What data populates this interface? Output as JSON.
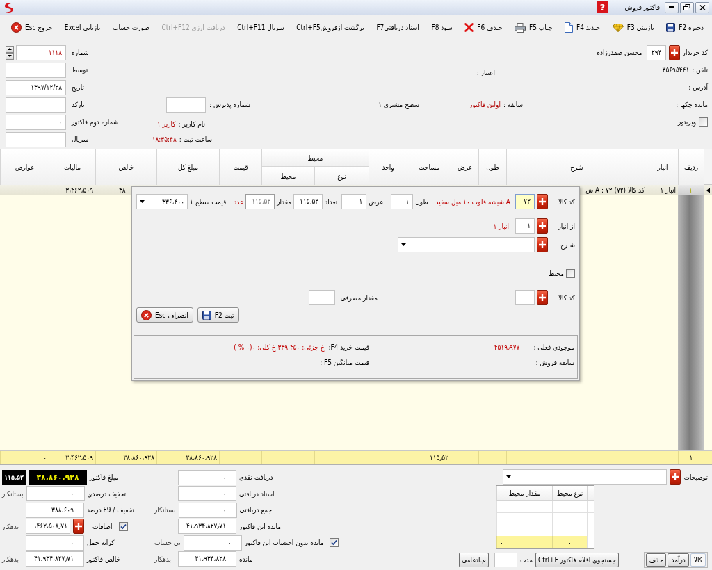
{
  "window": {
    "title": "فاکتور فروش",
    "help": "?"
  },
  "toolbar": [
    {
      "kind": "save",
      "label": "ذخیره F2",
      "disabled": false
    },
    {
      "kind": "review",
      "label": "بازبینی F3",
      "disabled": false
    },
    {
      "kind": "new",
      "label": "جـدید F4",
      "disabled": false
    },
    {
      "kind": "print",
      "label": "چـاپ F5",
      "disabled": false
    },
    {
      "kind": "delete",
      "label": "حـذف F6",
      "disabled": false
    },
    {
      "kind": "text",
      "label": "سود F8",
      "disabled": false
    },
    {
      "kind": "text",
      "label": "اسناد دریافتیF7",
      "disabled": false
    },
    {
      "kind": "text",
      "label": "برگشت ازفروشCtrl+F5",
      "disabled": false
    },
    {
      "kind": "text",
      "label": "سریال Ctrl+F11",
      "disabled": false
    },
    {
      "kind": "text",
      "label": "دریافت ارزی Ctrl+F12",
      "disabled": true
    },
    {
      "kind": "text",
      "label": "صورت حساب",
      "disabled": false
    },
    {
      "kind": "text",
      "label": "بازیابی Excel",
      "disabled": false
    },
    {
      "kind": "exit",
      "label": "خروج Esc",
      "disabled": false
    }
  ],
  "header": {
    "customer": {
      "code_label": "کد خریدار",
      "code": "۲۹۴",
      "name": "محسن صفدرزاده",
      "phone_label": "تلفن :",
      "phone": "۳۵۶۹۵۴۴۱",
      "address_label": "آدرس :",
      "cheques_label": "مانده چکها :",
      "visitor": {
        "label": "ویزیتور",
        "checked": false
      }
    },
    "credit_label": "اعتبار :",
    "history": {
      "label": "سابقه :",
      "value": "اولین فاکتور"
    },
    "customer_level": "سطح مشتری ۱",
    "reception_number": {
      "label": "شماره پذیرش :"
    },
    "user": {
      "label": "نام کاربر :",
      "value": "کاربر ۱"
    },
    "saved_time": {
      "label": "ساعت ثبت :",
      "value": "۱۸:۳۵:۴۸"
    },
    "invoice_fields": [
      {
        "kind": "spinner",
        "label": "شماره",
        "value": "۱۱۱۸"
      },
      {
        "kind": "text",
        "label": "توسط"
      },
      {
        "kind": "text",
        "label": "تاریخ",
        "value": "۱۳۹۷/۱۲/۲۸"
      },
      {
        "kind": "text",
        "label": "بارکد"
      },
      {
        "kind": "text",
        "label": "شماره دوم فاکتور",
        "value": "۰"
      },
      {
        "kind": "text",
        "label": "سریال"
      }
    ]
  },
  "table": {
    "columns": [
      {
        "label": "ردیف"
      },
      {
        "label": "انبار"
      },
      {
        "label": "شرح"
      },
      {
        "label": "طول"
      },
      {
        "label": "عرض"
      },
      {
        "label": "مساحت"
      },
      {
        "label": "واحد"
      },
      {
        "label": "نوع",
        "group": {
          "label": "محیط"
        }
      },
      {
        "label": "محیط",
        "in_group": true
      },
      {
        "label": "قیمت"
      },
      {
        "label": "مبلغ کل"
      },
      {
        "label": "خالص"
      },
      {
        "label": "مالیات"
      },
      {
        "label": "عوارض"
      }
    ],
    "rows": [
      {
        "selected": true,
        "cells": [
          "۱",
          "انبار ۱",
          "کد کالا (۷۲) ۷۲ : A ش",
          "",
          "",
          "",
          "",
          "",
          "",
          "",
          "",
          "۳۸",
          "۳،۴۶۲،۵۰۹",
          ""
        ]
      }
    ],
    "totals": {
      "cells": [
        "۱",
        "",
        "",
        "",
        "",
        "۱۱۵٫۵۲",
        "",
        "",
        "",
        "",
        "۳۸،۸۶۰،۹۲۸",
        "۳۸،۸۶۰،۹۲۸",
        "۳،۴۶۲،۵۰۹",
        "۰"
      ]
    }
  },
  "item_dialog": {
    "code_label": "کد کالا",
    "code": "۷۲",
    "item_name": "A شیشه فلوت ۱۰ میل سفید",
    "length": {
      "label": "طول",
      "value": "۱"
    },
    "width": {
      "label": "عرض",
      "value": "۱"
    },
    "count": {
      "label": "تعداد",
      "value": "۱۱۵٫۵۲"
    },
    "quantity": {
      "label": "مقدار",
      "value": "۱۱۵٫۵۲",
      "disabled": true
    },
    "unit": "عدد",
    "price": {
      "label": "قیمت سطح ۱",
      "value": "۳۳۶،۴۰۰"
    },
    "warehouse": {
      "label": "از انبار",
      "value": "۱",
      "name": "انبار ۱"
    },
    "description": {
      "label": "شـرح"
    },
    "perimeter": {
      "label": "محیط",
      "checked": false
    },
    "component": {
      "code_label": "کد کالا",
      "usage_label": "مقدار مصرفی"
    },
    "buttons": [
      {
        "kind": "save",
        "label": "ثبت F2"
      },
      {
        "kind": "cancel",
        "label": "انصراف Esc"
      }
    ],
    "stock": {
      "label": "موجودی فعلی :",
      "value": "۴۵۱۹٫۹۷۷"
    },
    "sales_history": {
      "label": "سابقه فروش :"
    },
    "purchase_price": {
      "label": "قیمت خرید F4:",
      "value": "خ جزئی: ۳۳۹،۴۵۰ خ کلی: ۰(۰ % )"
    },
    "average_price": {
      "label": "قیمت میانگین F5 :"
    }
  },
  "footer": {
    "amounts": [
      {
        "kind": "display",
        "label": "مبلغ فاکتور",
        "value": "۳۸،۸۶۰،۹۲۸",
        "quantity": "۱۱۵٫۵۲"
      },
      {
        "kind": "field",
        "label": "تخفیف درصدی",
        "value": "۰",
        "note": "بستانکار"
      },
      {
        "kind": "field",
        "label": "تخفیف / F9 درصد",
        "value": "۳۸۸،۶۰۹"
      },
      {
        "kind": "extra",
        "label": "اضافات",
        "checked": true,
        "value": "،۴۶۲،۵۰۸٫۷۱",
        "note": "بدهکار"
      },
      {
        "kind": "field",
        "label": "کرایه حمل",
        "value": "۰"
      },
      {
        "kind": "field",
        "label": "خالص فاکتور",
        "value": "۴۱،۹۳۴،۸۲۷٫۷۱",
        "note": "بدهکار"
      }
    ],
    "payments": [
      {
        "kind": "field",
        "label": "دریافت نقدی",
        "value": "۰"
      },
      {
        "kind": "field",
        "label": "اسناد دریافتی",
        "value": "۰"
      },
      {
        "kind": "field",
        "label": "جمع دریافتی",
        "value": "۰",
        "note": "بستانکار"
      },
      {
        "kind": "field",
        "label": "مانده این فاکتور",
        "value": "۴۱،۹۳۴،۸۲۷٫۷۱"
      },
      {
        "kind": "check",
        "label": "مانده بدون احتساب این فاکتور",
        "checked": true,
        "value": "۰",
        "note": "بی حساب"
      },
      {
        "kind": "field",
        "label": "مانده",
        "value": "۴۱،۹۳۴،۸۲۸",
        "note": "بدهکار"
      }
    ],
    "notes": {
      "label": "توضیحات"
    },
    "perimeter_grid": {
      "columns": [
        "نوع محیط",
        "مقدار محیط"
      ],
      "totals": [
        "۰",
        "۰"
      ]
    },
    "tabs": [
      {
        "label": "کالا",
        "selected": true
      },
      {
        "label": "درآمد",
        "selected": false
      },
      {
        "label": "حذف",
        "selected": false
      }
    ],
    "search_button": "جستجوی اقلام فاکتور Ctrl+F",
    "duration_label": "مدت",
    "merge_button": "م.ادغامی"
  }
}
